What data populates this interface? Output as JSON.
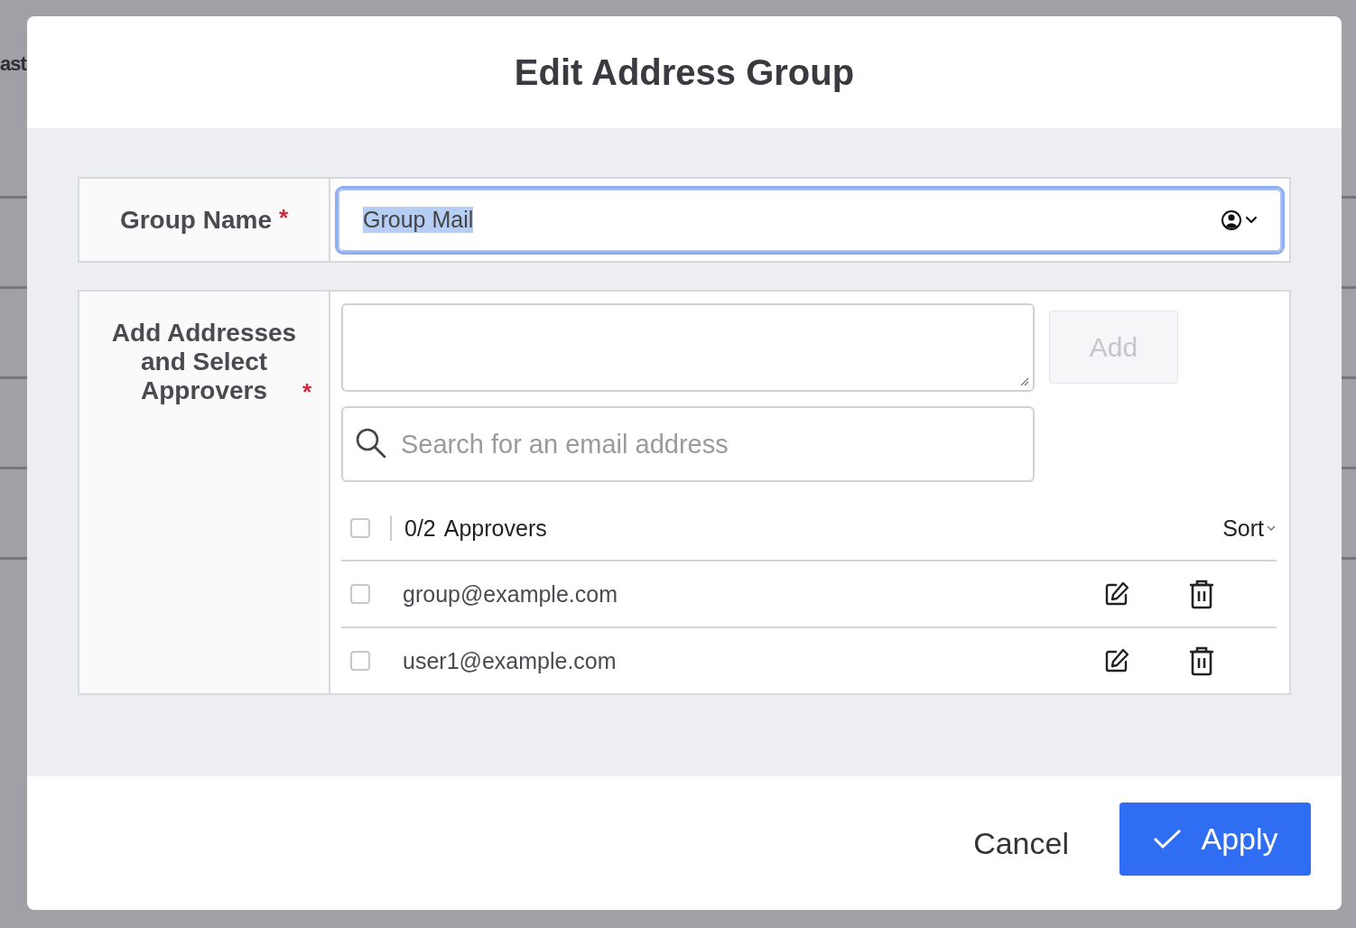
{
  "background": {
    "heading": "ast"
  },
  "dialog": {
    "title": "Edit Address Group",
    "group_name": {
      "label": "Group Name",
      "required_mark": "*",
      "value": "Group Mail",
      "text_selected": true,
      "focused": true
    },
    "addresses": {
      "label": "Add Addresses and Select Approvers",
      "required_mark": "*",
      "add_button": {
        "label": "Add",
        "disabled": true
      },
      "search": {
        "placeholder": "Search for an email address"
      },
      "approvers_header": {
        "checked": false,
        "count": "0/2",
        "label": "Approvers",
        "sort": "Sort"
      },
      "entries": [
        {
          "email": "group@example.com",
          "checked": false
        },
        {
          "email": "user1@example.com",
          "checked": false
        }
      ]
    },
    "buttons": {
      "cancel": "Cancel",
      "apply": "Apply"
    }
  }
}
